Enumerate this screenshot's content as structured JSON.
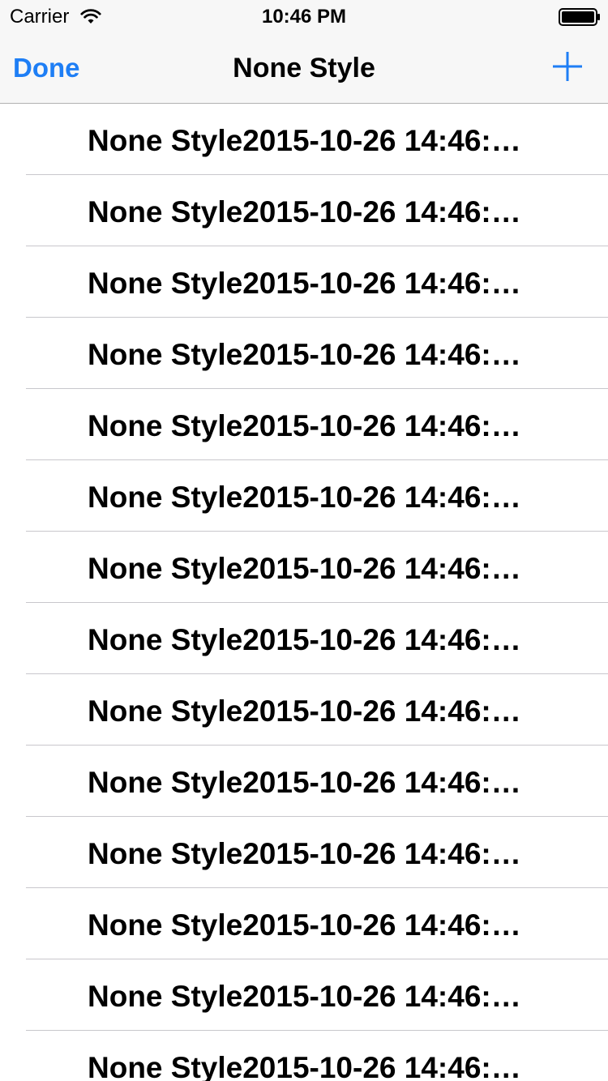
{
  "status_bar": {
    "carrier": "Carrier",
    "time": "10:46 PM",
    "wifi_icon": "wifi-icon",
    "battery_icon": "battery-icon"
  },
  "nav": {
    "left_button": "Done",
    "title": "None Style",
    "right_button_icon": "plus-icon"
  },
  "colors": {
    "accent": "#1e7ef5",
    "nav_background": "#f7f7f7",
    "separator": "#c8c7cc"
  },
  "list": {
    "items": [
      {
        "label": "None Style2015-10-26 14:46:…"
      },
      {
        "label": "None Style2015-10-26 14:46:…"
      },
      {
        "label": "None Style2015-10-26 14:46:…"
      },
      {
        "label": "None Style2015-10-26 14:46:…"
      },
      {
        "label": "None Style2015-10-26 14:46:…"
      },
      {
        "label": "None Style2015-10-26 14:46:…"
      },
      {
        "label": "None Style2015-10-26 14:46:…"
      },
      {
        "label": "None Style2015-10-26 14:46:…"
      },
      {
        "label": "None Style2015-10-26 14:46:…"
      },
      {
        "label": "None Style2015-10-26 14:46:…"
      },
      {
        "label": "None Style2015-10-26 14:46:…"
      },
      {
        "label": "None Style2015-10-26 14:46:…"
      },
      {
        "label": "None Style2015-10-26 14:46:…"
      },
      {
        "label": "None Style2015-10-26 14:46:…"
      }
    ]
  }
}
